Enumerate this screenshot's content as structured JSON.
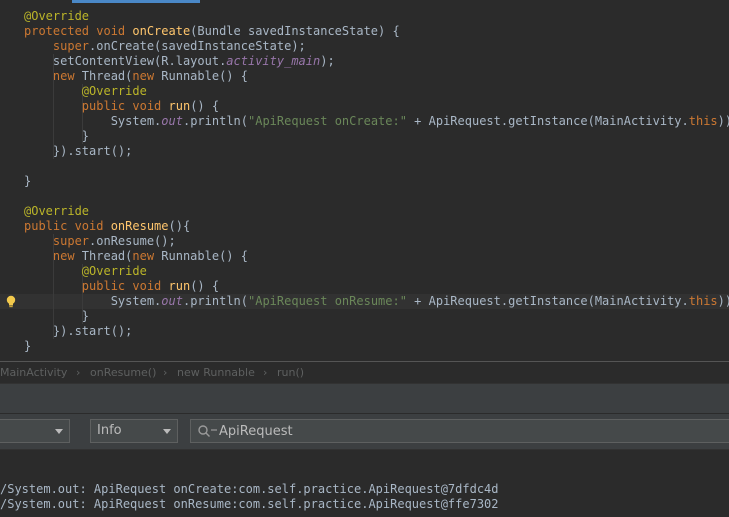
{
  "editor": {
    "lines": [
      {
        "tokens": [
          {
            "t": "@Override",
            "c": "ann"
          }
        ]
      },
      {
        "tokens": [
          {
            "t": "protected void ",
            "c": "kw"
          },
          {
            "t": "onCreate",
            "c": "fn"
          },
          {
            "t": "(Bundle savedInstanceState) {",
            "c": ""
          }
        ]
      },
      {
        "tokens": [
          {
            "t": "    super",
            "c": "kw"
          },
          {
            "t": ".onCreate(savedInstanceState);",
            "c": ""
          }
        ]
      },
      {
        "tokens": [
          {
            "t": "    setContentView(R.layout.",
            "c": ""
          },
          {
            "t": "activity_main",
            "c": "fld"
          },
          {
            "t": ");",
            "c": ""
          }
        ]
      },
      {
        "tokens": [
          {
            "t": "    new ",
            "c": "kw"
          },
          {
            "t": "Thread(",
            "c": ""
          },
          {
            "t": "new ",
            "c": "kw"
          },
          {
            "t": "Runnable() {",
            "c": ""
          }
        ]
      },
      {
        "tokens": [
          {
            "t": "        @Override",
            "c": "ann"
          }
        ]
      },
      {
        "tokens": [
          {
            "t": "        public void ",
            "c": "kw"
          },
          {
            "t": "run",
            "c": "fn"
          },
          {
            "t": "() {",
            "c": ""
          }
        ]
      },
      {
        "tokens": [
          {
            "t": "            System.",
            "c": ""
          },
          {
            "t": "out",
            "c": "fld"
          },
          {
            "t": ".println(",
            "c": ""
          },
          {
            "t": "\"ApiRequest onCreate:\"",
            "c": "str"
          },
          {
            "t": " + ApiRequest.",
            "c": ""
          },
          {
            "t": "getInstance",
            "c": "mth"
          },
          {
            "t": "(MainActivity.",
            "c": ""
          },
          {
            "t": "this",
            "c": "kw"
          },
          {
            "t": "));",
            "c": ""
          }
        ]
      },
      {
        "tokens": [
          {
            "t": "        }",
            "c": ""
          }
        ]
      },
      {
        "tokens": [
          {
            "t": "    }).start();",
            "c": ""
          }
        ]
      },
      {
        "tokens": [
          {
            "t": "",
            "c": ""
          }
        ]
      },
      {
        "tokens": [
          {
            "t": "}",
            "c": ""
          }
        ]
      },
      {
        "tokens": [
          {
            "t": "",
            "c": ""
          }
        ]
      },
      {
        "tokens": [
          {
            "t": "@Override",
            "c": "ann"
          }
        ]
      },
      {
        "tokens": [
          {
            "t": "public void ",
            "c": "kw"
          },
          {
            "t": "onResume",
            "c": "fn"
          },
          {
            "t": "(){",
            "c": ""
          }
        ]
      },
      {
        "tokens": [
          {
            "t": "    super",
            "c": "kw"
          },
          {
            "t": ".onResume();",
            "c": ""
          }
        ]
      },
      {
        "tokens": [
          {
            "t": "    new ",
            "c": "kw"
          },
          {
            "t": "Thread(",
            "c": ""
          },
          {
            "t": "new ",
            "c": "kw"
          },
          {
            "t": "Runnable() {",
            "c": ""
          }
        ]
      },
      {
        "tokens": [
          {
            "t": "        @Override",
            "c": "ann"
          }
        ]
      },
      {
        "tokens": [
          {
            "t": "        public void ",
            "c": "kw"
          },
          {
            "t": "run",
            "c": "fn"
          },
          {
            "t": "() {",
            "c": ""
          }
        ]
      },
      {
        "tokens": [
          {
            "t": "            System.",
            "c": ""
          },
          {
            "t": "out",
            "c": "fld"
          },
          {
            "t": ".println(",
            "c": ""
          },
          {
            "t": "\"ApiRequest onResume:\"",
            "c": "str"
          },
          {
            "t": " + ApiRequest.",
            "c": ""
          },
          {
            "t": "getInstance",
            "c": "mth"
          },
          {
            "t": "(MainActivity.",
            "c": ""
          },
          {
            "t": "this",
            "c": "kw"
          },
          {
            "t": "));",
            "c": ""
          }
        ]
      },
      {
        "tokens": [
          {
            "t": "        }",
            "c": ""
          }
        ]
      },
      {
        "tokens": [
          {
            "t": "    }).start();",
            "c": ""
          }
        ]
      },
      {
        "tokens": [
          {
            "t": "}",
            "c": ""
          }
        ]
      }
    ],
    "current_line_index": 19
  },
  "breadcrumb": {
    "items": [
      "MainActivity",
      "onResume()",
      "new Runnable",
      "run()"
    ],
    "separator": "›"
  },
  "filters": {
    "device_value": "",
    "level_value": "Info",
    "search_value": "ApiRequest"
  },
  "log": {
    "lines": [
      "/System.out: ApiRequest onCreate:com.self.practice.ApiRequest@7dfdc4d",
      "/System.out: ApiRequest onResume:com.self.practice.ApiRequest@ffe7302"
    ]
  },
  "icons": {
    "bulb": "lightbulb-icon",
    "search": "search-icon",
    "dropdown": "chevron-down-icon"
  },
  "colors": {
    "background": "#2b2b2b",
    "panel": "#3c3f41",
    "keyword": "#cc7832",
    "annotation": "#bbb529",
    "method": "#ffc66d",
    "string": "#6a8759",
    "field": "#9876aa",
    "text": "#a9b7c6"
  }
}
